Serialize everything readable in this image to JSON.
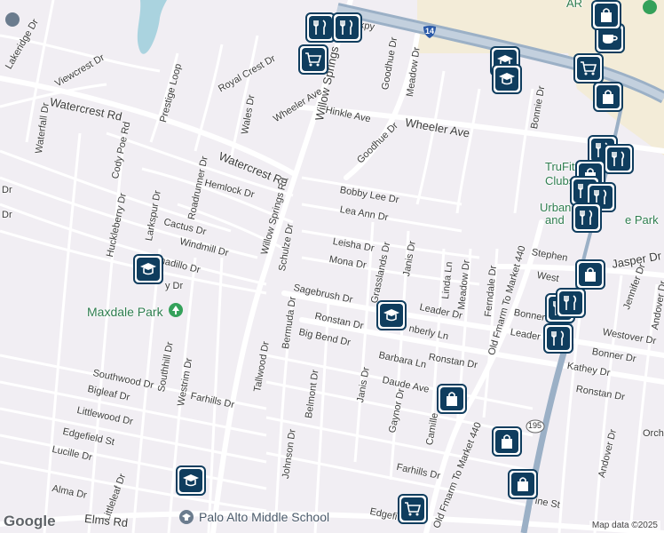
{
  "map": {
    "provider_logo": "Google",
    "attribution": "Map data ©2025",
    "colors": {
      "background": "#f1eef3",
      "road": "#ffffff",
      "highway": "#9bb0c6",
      "water": "#aad3df",
      "park": "#cde8d2",
      "commercial": "#f3ecd8",
      "marker": "#0f3d5e"
    }
  },
  "streets": {
    "waterfall": "Waterfall Dr",
    "lakeridge": "Lakeridge Dr",
    "viewcrest": "Viewcrest Dr",
    "prestige_loop": "Prestige Loop",
    "royal_crest": "Royal Crest Dr",
    "wales": "Wales Dr",
    "watercrest_rd_w": "Watercrest Rd",
    "watercrest_rd_e": "Watercrest Rd",
    "wheeler_ave_w": "Wheeler Ave",
    "wheeler_ave_e": "Wheeler Ave",
    "willow_springs_n": "Willow Springs",
    "willow_springs_rd": "Willow Springs Rd",
    "hinkle": "Hinkle Ave",
    "goodhue_n": "Goodhue Dr",
    "goodhue_s": "Goodhue Dr",
    "meadow_n": "Meadow Dr",
    "expy": "xpy",
    "bonnie": "Bonnie Dr",
    "cody_poe": "Cody Poe Rd",
    "hemlock": "Hemlock Dr",
    "roadrunner": "Roadrunner Dr",
    "bobby_lee": "Bobby Lee Dr",
    "lea_ann": "Lea Ann Dr",
    "huckleberry": "Huckleberry Dr",
    "larkspur": "Larkspur Dr",
    "cactus": "Cactus Dr",
    "windmill": "Windmill Dr",
    "armadillo": "Armadillo Dr",
    "schulze": "Schulze Dr",
    "leisha": "Leisha Dr",
    "mona": "Mona Dr",
    "janis_n": "Janis Dr",
    "janis_s": "Janis Dr",
    "grasslands": "Grasslands Dr",
    "sagebrush": "Sagebrush Dr",
    "ronstan_w": "Ronstan Dr",
    "ronstan_mid": "Ronstan Dr",
    "ronstan_e": "Ronstan Dr",
    "bermuda": "Bermuda Dr",
    "big_bend": "Big Bend Dr",
    "kimberly": "nberly Ln",
    "leader_w": "Leader Dr",
    "leader_e": "Leader",
    "linda": "Linda Ln",
    "meadow_s": "Meadow Dr",
    "ferndale": "Ferndale Dr",
    "old_fm_440_n": "Old Fmarm To Market 440",
    "old_fm_440_s": "Old Fmarm To Market 440",
    "stephen": "Stephen",
    "jasper": "Jasper Dr",
    "west": "West",
    "jennifer": "Jennifer Dr",
    "andover_n": "Andover Dr",
    "andover_s": "Andover Dr",
    "bonner_n": "Bonner",
    "bonner_s": "Bonner Dr",
    "westover": "Westover Dr",
    "kathey": "Kathey Dr",
    "orchid": "Orchi",
    "barbara": "Barbara Ln",
    "daude": "Daude Ave",
    "gaynor": "Gaynor Dr",
    "camille": "Camille",
    "southwood": "Southwood Dr",
    "southhill": "Southhill Dr",
    "westrim": "Westrim Dr",
    "bigleaf": "Bigleaf Dr",
    "farhills_w": "Farhills Dr",
    "farhills_e": "Farhills Dr",
    "tallwood": "Tallwood Dr",
    "belmont": "Belmont Dr",
    "littlewood": "Littlewood Dr",
    "edgefield_w": "Edgefield St",
    "edgefield_e": "Edgefi",
    "lucille": "Lucille Dr",
    "alma": "Alma Dr",
    "littleleaf": "Littleleaf Dr",
    "johnson": "Johnson Dr",
    "elms": "Elms Rd",
    "pine": "ine St",
    "dr_fragment_1": "Dr",
    "dr_fragment_2": "Dr",
    "dr_fragment_3": "y Dr"
  },
  "places": {
    "maxdale_park": "Maxdale Park",
    "palo_alto_ms": "Palo Alto Middle School",
    "trufit_1": "TruFit",
    "trufit_2": "Clubs - F",
    "urban_1": "Urban",
    "urban_2": "and",
    "urban_3": "e Park",
    "ar_fragment": "AR"
  },
  "shields": {
    "i14": "14",
    "route_195": "195"
  },
  "markers": [
    {
      "icon": "restaurant"
    },
    {
      "icon": "restaurant"
    },
    {
      "icon": "shopping-cart"
    },
    {
      "icon": "school"
    },
    {
      "icon": "school"
    },
    {
      "icon": "shopping-bag"
    },
    {
      "icon": "cafe"
    },
    {
      "icon": "shopping-cart"
    },
    {
      "icon": "shopping-bag"
    },
    {
      "icon": "restaurant"
    },
    {
      "icon": "restaurant"
    },
    {
      "icon": "shopping-bag"
    },
    {
      "icon": "restaurant"
    },
    {
      "icon": "restaurant"
    },
    {
      "icon": "restaurant"
    },
    {
      "icon": "shopping-bag"
    },
    {
      "icon": "restaurant"
    },
    {
      "icon": "restaurant"
    },
    {
      "icon": "school"
    },
    {
      "icon": "school"
    },
    {
      "icon": "shopping-bag"
    },
    {
      "icon": "shopping-bag"
    },
    {
      "icon": "shopping-bag"
    },
    {
      "icon": "school"
    },
    {
      "icon": "shopping-cart"
    },
    {
      "icon": "restaurant"
    }
  ]
}
